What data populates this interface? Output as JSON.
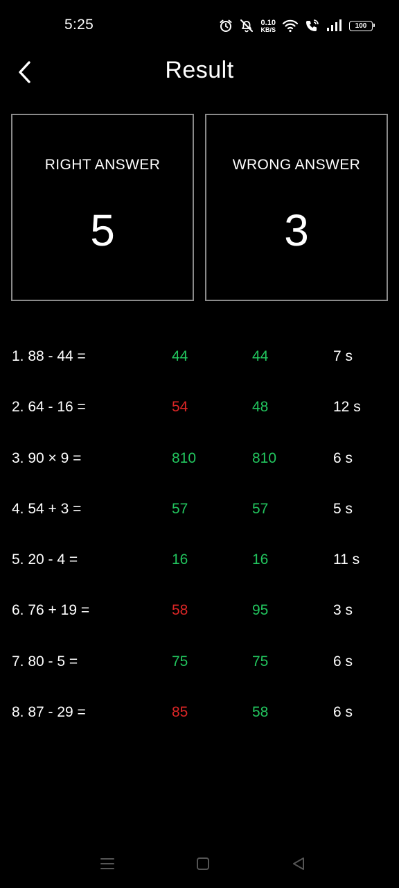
{
  "status_bar": {
    "time": "5:25",
    "net_speed_value": "0.10",
    "net_speed_unit": "KB/S",
    "battery": "100",
    "icons": [
      "alarm-icon",
      "mute-icon",
      "wifi-icon",
      "call-icon",
      "signal-icon",
      "battery-icon"
    ]
  },
  "header": {
    "title": "Result",
    "back_icon": "back-arrow-icon"
  },
  "summary": {
    "right_label": "RIGHT ANSWER",
    "right_value": "5",
    "wrong_label": "WRONG ANSWER",
    "wrong_value": "3"
  },
  "results": [
    {
      "question": "1. 88 - 44 =",
      "user_answer": "44",
      "correct_answer": "44",
      "time": "7 s",
      "is_correct": true
    },
    {
      "question": "2. 64 - 16 =",
      "user_answer": "54",
      "correct_answer": "48",
      "time": "12 s",
      "is_correct": false
    },
    {
      "question": "3. 90 × 9 =",
      "user_answer": "810",
      "correct_answer": "810",
      "time": "6 s",
      "is_correct": true
    },
    {
      "question": "4. 54 + 3 =",
      "user_answer": "57",
      "correct_answer": "57",
      "time": "5 s",
      "is_correct": true
    },
    {
      "question": "5. 20 - 4 =",
      "user_answer": "16",
      "correct_answer": "16",
      "time": "11 s",
      "is_correct": true
    },
    {
      "question": "6. 76 + 19 =",
      "user_answer": "58",
      "correct_answer": "95",
      "time": "3 s",
      "is_correct": false
    },
    {
      "question": "7. 80 - 5 =",
      "user_answer": "75",
      "correct_answer": "75",
      "time": "6 s",
      "is_correct": true
    },
    {
      "question": "8. 87 - 29 =",
      "user_answer": "85",
      "correct_answer": "58",
      "time": "6 s",
      "is_correct": false
    }
  ],
  "colors": {
    "background": "#000000",
    "text": "#ffffff",
    "correct": "#22c55e",
    "incorrect": "#dc2626",
    "card_border": "#8a8a8a"
  },
  "nav_bar": {
    "icons": [
      "menu-icon",
      "home-icon",
      "back-triangle-icon"
    ]
  }
}
